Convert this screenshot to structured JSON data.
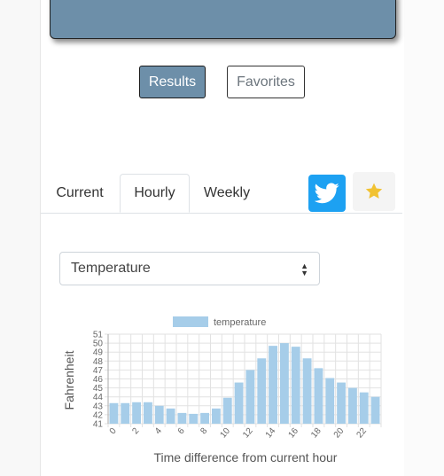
{
  "buttons": {
    "results": "Results",
    "favorites": "Favorites"
  },
  "tabs": [
    {
      "label": "Current"
    },
    {
      "label": "Hourly"
    },
    {
      "label": "Weekly"
    }
  ],
  "share": {
    "twitter_icon": "twitter-icon",
    "star_icon": "star-icon"
  },
  "select": {
    "value": "Temperature"
  },
  "colors": {
    "banner": "#6d8fa9",
    "bar": "#a6cde9",
    "twitter": "#1da1f2",
    "star": "#f1c232"
  },
  "chart_data": {
    "type": "bar",
    "legend": "temperature",
    "xlabel": "Time difference from current hour",
    "ylabel": "Fahrenheit",
    "x": [
      0,
      1,
      2,
      3,
      4,
      5,
      6,
      7,
      8,
      9,
      10,
      11,
      12,
      13,
      14,
      15,
      16,
      17,
      18,
      19,
      20,
      21,
      22,
      23
    ],
    "x_tick_labels": [
      "0",
      "2",
      "4",
      "6",
      "8",
      "10",
      "12",
      "14",
      "16",
      "18",
      "20",
      "22"
    ],
    "values": [
      43.3,
      43.3,
      43.4,
      43.4,
      43.0,
      42.7,
      42.2,
      42.1,
      42.2,
      42.7,
      43.9,
      45.6,
      47.0,
      48.3,
      49.7,
      50.0,
      49.6,
      48.3,
      47.2,
      46.1,
      45.6,
      45.0,
      44.5,
      44.0
    ],
    "ylim": [
      41,
      51
    ],
    "y_ticks": [
      41,
      42,
      43,
      44,
      45,
      46,
      47,
      48,
      49,
      50,
      51
    ],
    "grid": true,
    "legend_position": "top"
  }
}
